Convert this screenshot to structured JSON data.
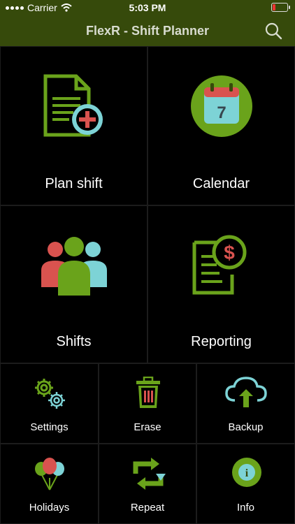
{
  "status_bar": {
    "carrier": "Carrier",
    "time": "5:03 PM"
  },
  "header": {
    "title": "FlexR - Shift Planner",
    "search_icon": "search-icon"
  },
  "tiles": {
    "plan_shift": {
      "label": "Plan shift",
      "icon": "add-document-icon"
    },
    "calendar": {
      "label": "Calendar",
      "icon": "calendar-icon",
      "day": "7"
    },
    "shifts": {
      "label": "Shifts",
      "icon": "people-icon"
    },
    "reporting": {
      "label": "Reporting",
      "icon": "invoice-dollar-icon",
      "symbol": "$"
    },
    "settings": {
      "label": "Settings",
      "icon": "gears-icon"
    },
    "erase": {
      "label": "Erase",
      "icon": "trash-icon"
    },
    "backup": {
      "label": "Backup",
      "icon": "cloud-upload-icon"
    },
    "holidays": {
      "label": "Holidays",
      "icon": "balloons-icon"
    },
    "repeat": {
      "label": "Repeat",
      "icon": "repeat-icon"
    },
    "info": {
      "label": "Info",
      "icon": "info-icon",
      "symbol": "i"
    }
  },
  "colors": {
    "header": "#364a0b",
    "green": "#6aa31b",
    "red": "#d9534f",
    "teal": "#7dd3d6",
    "background": "#000000"
  }
}
